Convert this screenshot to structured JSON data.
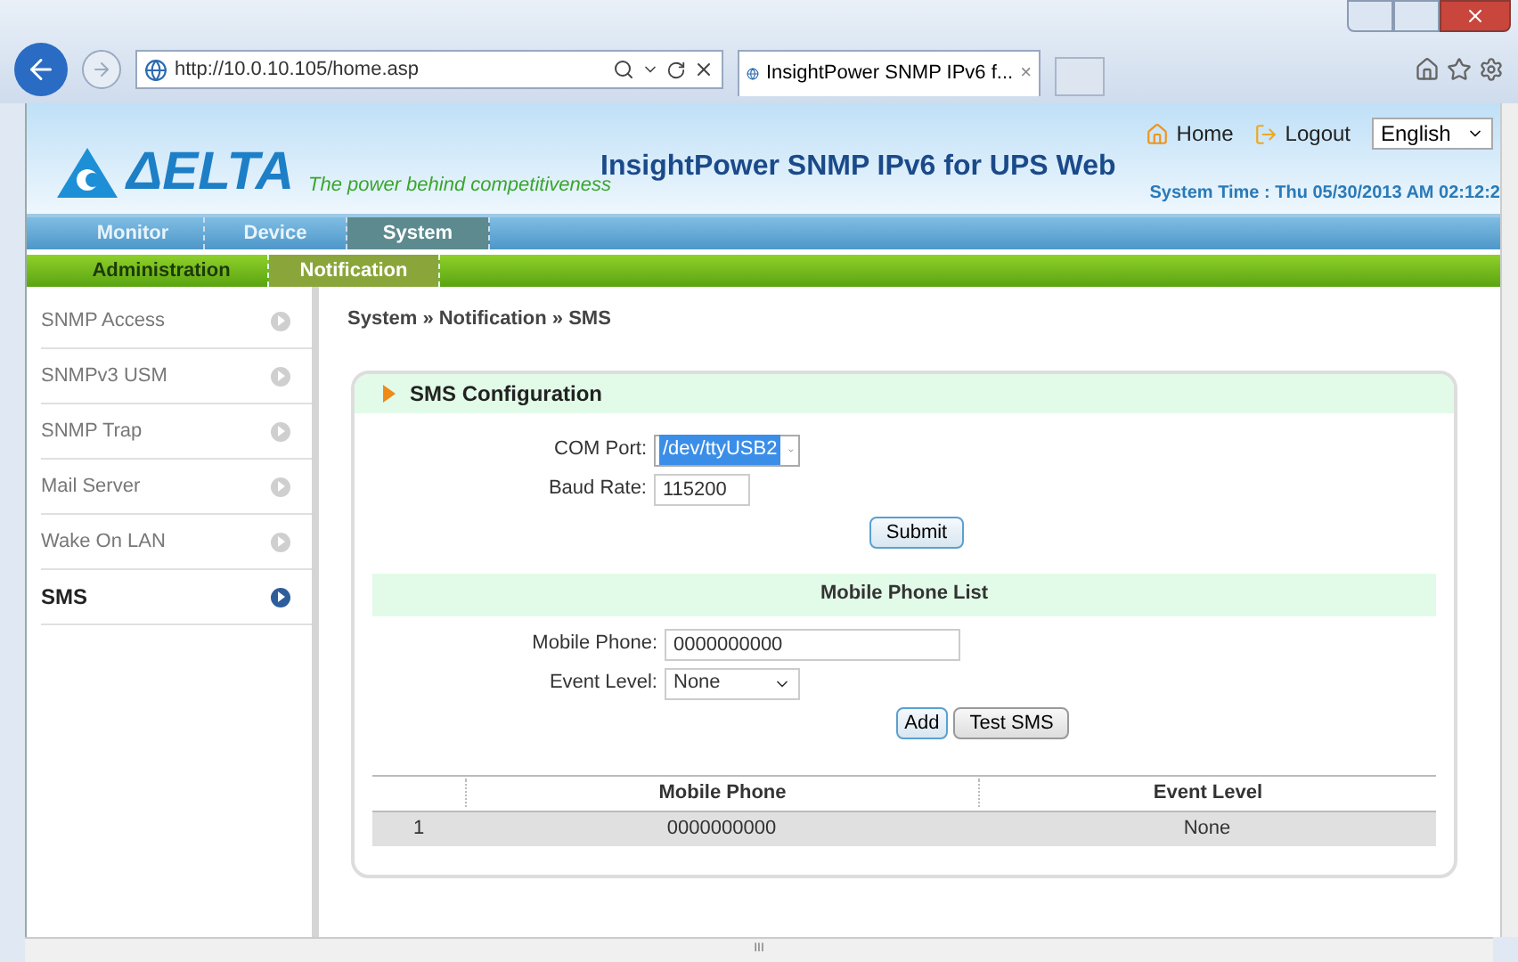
{
  "browser": {
    "address": "http://10.0.10.105/home.asp",
    "tab_title": "InsightPower SNMP IPv6 f...",
    "tab_close": "×"
  },
  "header": {
    "brand": "ΔELTA",
    "tagline": "The power behind competitiveness",
    "title": "InsightPower SNMP IPv6 for UPS Web",
    "links": [
      {
        "label": "Home",
        "kind": "home"
      },
      {
        "label": "Logout",
        "kind": "logout"
      }
    ],
    "language": "English",
    "system_time": "System Time : Thu 05/30/2013 AM 02:12:2"
  },
  "nav": [
    {
      "label": "Monitor",
      "selected": false
    },
    {
      "label": "Device",
      "selected": false
    },
    {
      "label": "System",
      "selected": true
    }
  ],
  "subnav": [
    {
      "label": "Administration",
      "selected": false
    },
    {
      "label": "Notification",
      "selected": true
    }
  ],
  "sidebar": [
    {
      "label": "SNMP Access",
      "selected": false
    },
    {
      "label": "SNMPv3 USM",
      "selected": false
    },
    {
      "label": "SNMP Trap",
      "selected": false
    },
    {
      "label": "Mail Server",
      "selected": false
    },
    {
      "label": "Wake On LAN",
      "selected": false
    },
    {
      "label": "SMS",
      "selected": true
    }
  ],
  "breadcrumb": "System » Notification » SMS",
  "panel": {
    "title": "SMS Configuration",
    "com_port_label": "COM Port:",
    "com_port": "/dev/ttyUSB2",
    "baud_label": "Baud Rate:",
    "baud": "115200",
    "submit": "Submit",
    "list_title": "Mobile Phone List",
    "phone_label": "Mobile Phone:",
    "phone": "0000000000",
    "level_label": "Event Level:",
    "level": "None",
    "add": "Add",
    "test": "Test SMS",
    "columns": [
      "",
      "Mobile Phone",
      "Event Level"
    ],
    "rows": [
      [
        "1",
        "0000000000",
        "None"
      ]
    ]
  },
  "scrollbar": {
    "grip": "III"
  }
}
